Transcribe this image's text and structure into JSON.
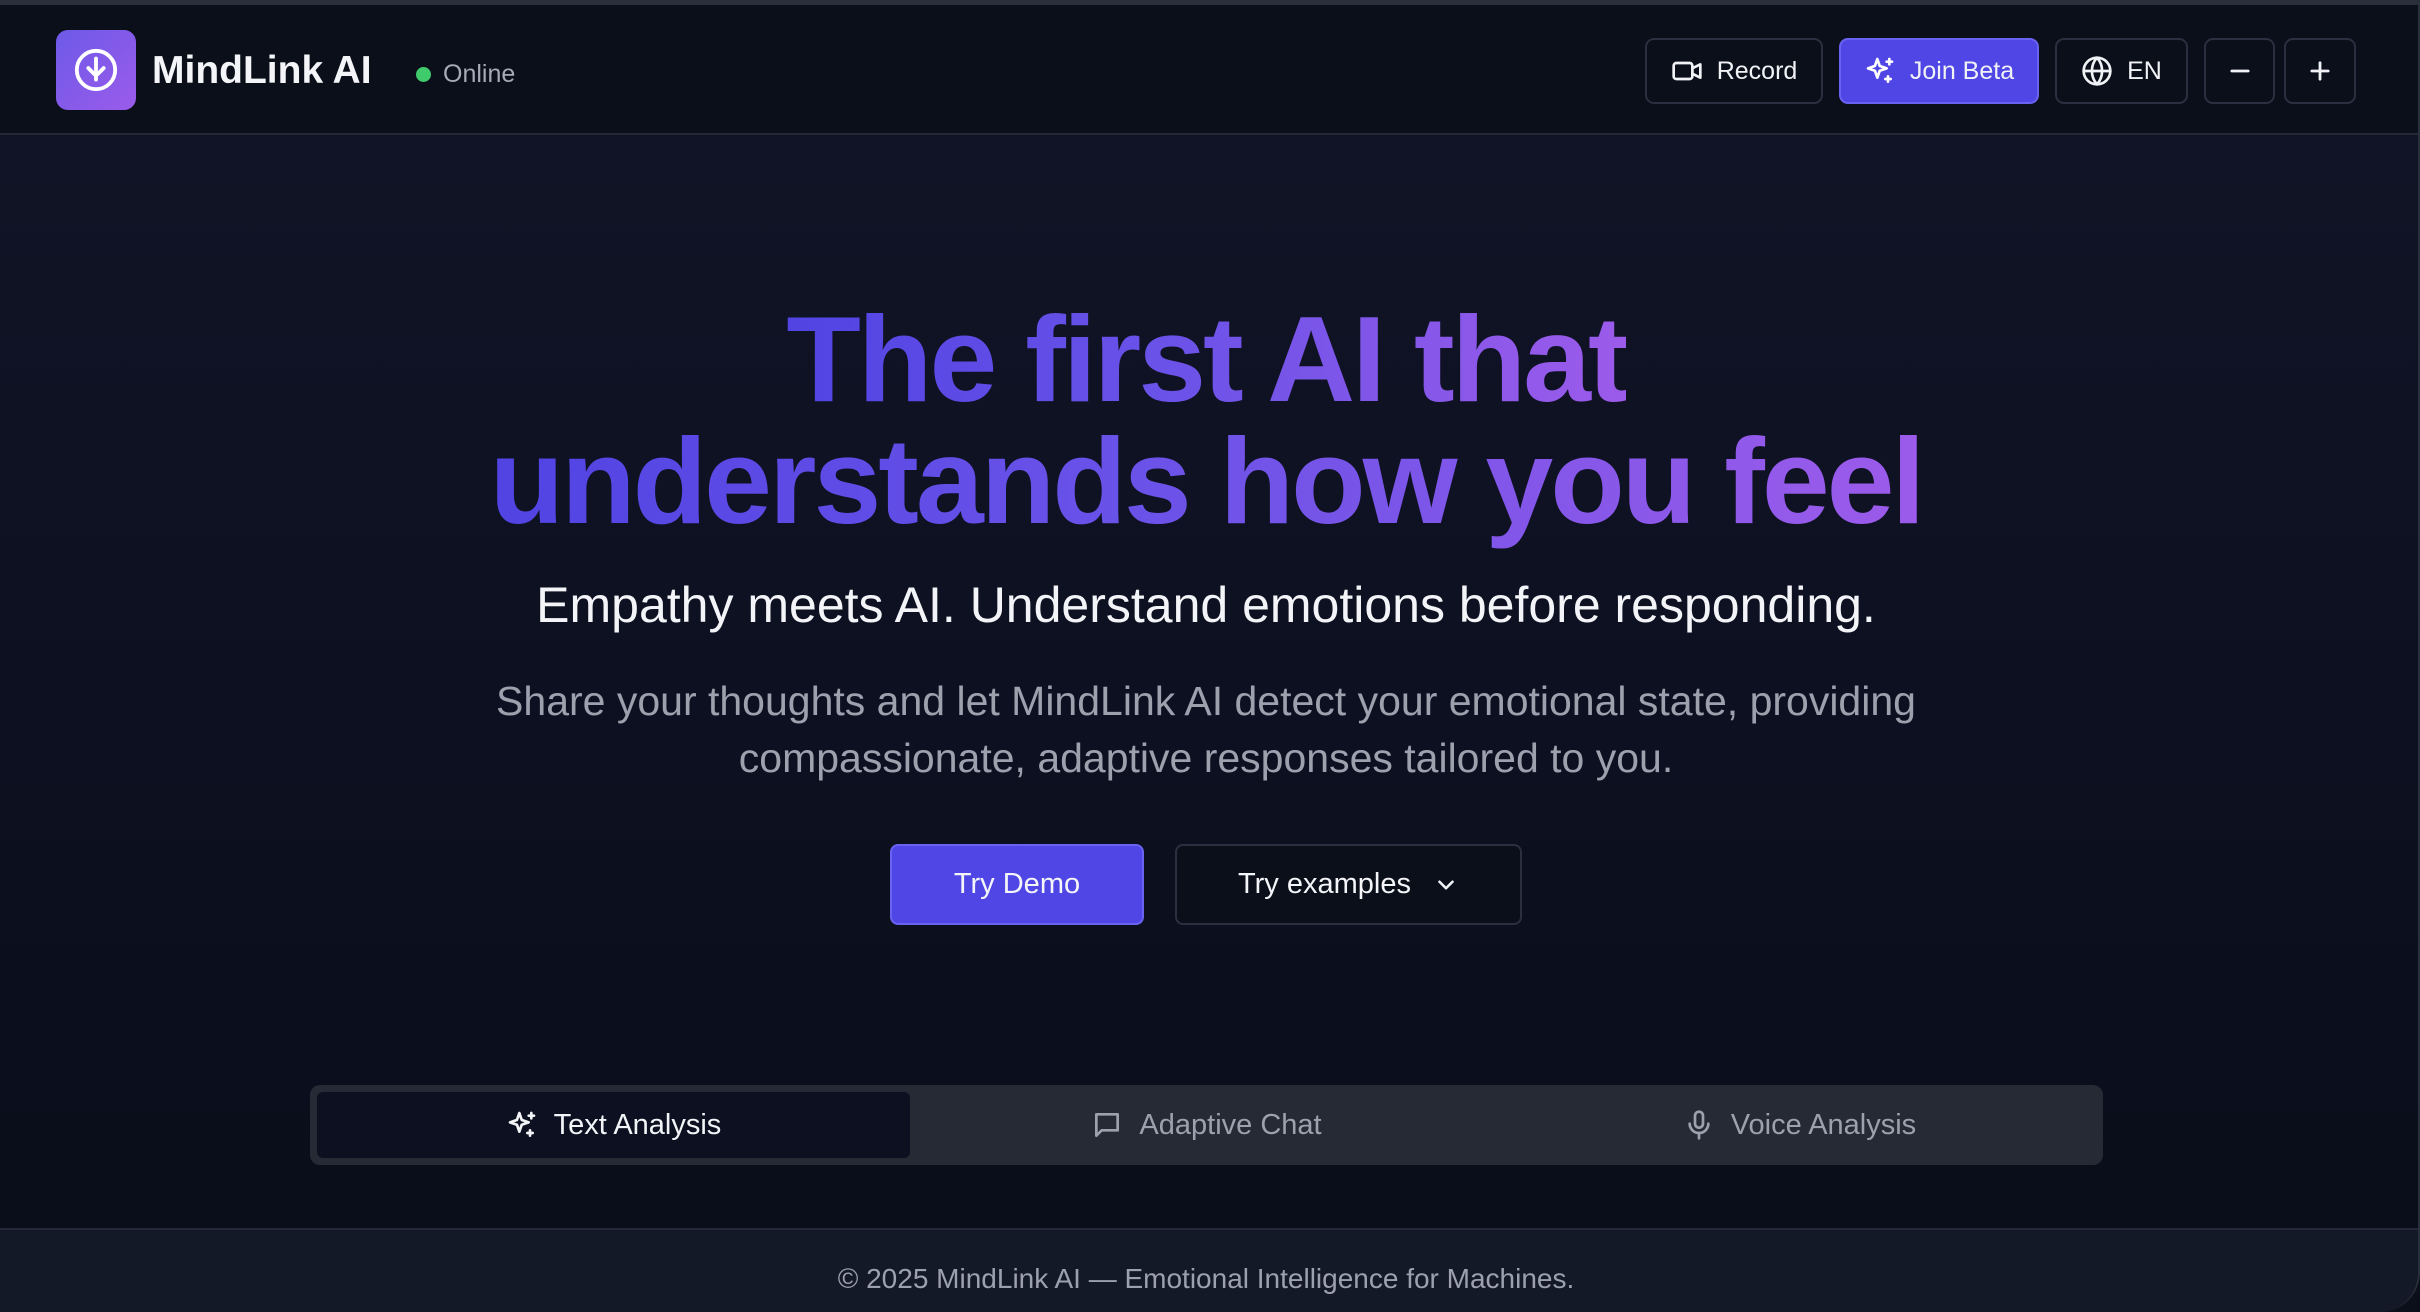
{
  "header": {
    "brand_name": "MindLink AI",
    "status_label": "Online",
    "status_color": "#3fca6b",
    "logo_icon": "brain-download-icon",
    "record_label": "Record",
    "record_icon": "video-camera-icon",
    "beta_label": "Join Beta",
    "beta_icon": "sparkles-icon",
    "language_label": "EN",
    "language_icon": "globe-icon",
    "zoom_out_icon": "minus-icon",
    "zoom_in_icon": "plus-icon"
  },
  "hero": {
    "title_line1": "The first AI that",
    "title_line2": "understands how you feel",
    "subtitle": "Empathy meets AI. Understand emotions before responding.",
    "description": "Share your thoughts and let MindLink AI detect your emotional state, providing compassionate, adaptive responses tailored to you.",
    "primary_cta": "Try Demo",
    "secondary_cta": "Try examples",
    "secondary_cta_icon": "chevron-down-icon"
  },
  "tabs": [
    {
      "label": "Text Analysis",
      "icon": "sparkles-icon",
      "active": true
    },
    {
      "label": "Adaptive Chat",
      "icon": "chat-bubble-icon",
      "active": false
    },
    {
      "label": "Voice Analysis",
      "icon": "microphone-icon",
      "active": false
    }
  ],
  "footer": {
    "text": "© 2025 MindLink AI — Emotional Intelligence for Machines."
  },
  "colors": {
    "accent": "#4f46e5",
    "gradient_start": "#5144e3",
    "gradient_end": "#9c5bea",
    "background": "#0c1020"
  }
}
